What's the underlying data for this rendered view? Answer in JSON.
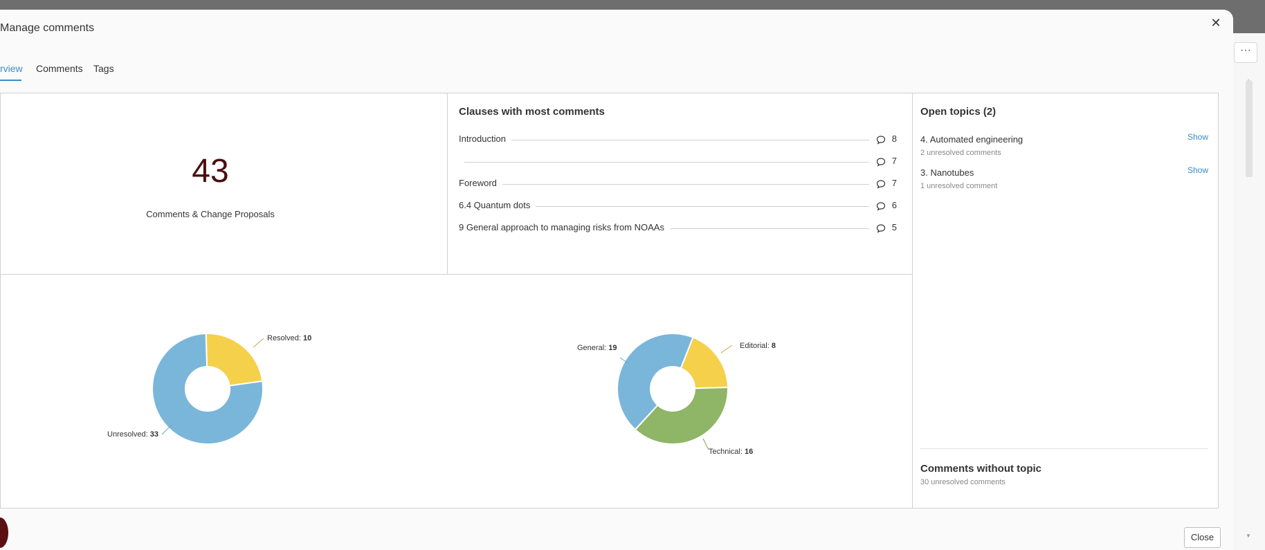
{
  "modal": {
    "title": "Manage comments",
    "close_icon": "close-icon",
    "close_button": "Close"
  },
  "tabs": [
    {
      "label": "rview",
      "active": true
    },
    {
      "label": "Comments",
      "active": false
    },
    {
      "label": "Tags",
      "active": false
    }
  ],
  "summary": {
    "total": "43",
    "label": "Comments & Change Proposals"
  },
  "clauses": {
    "title": "Clauses with most comments",
    "items": [
      {
        "name": "Introduction",
        "count": "8"
      },
      {
        "name": "",
        "count": "7"
      },
      {
        "name": "Foreword",
        "count": "7"
      },
      {
        "name": "6.4 Quantum dots",
        "count": "6"
      },
      {
        "name": "9 General approach to managing risks from NOAAs",
        "count": "5"
      }
    ]
  },
  "topics": {
    "title": "Open topics (2)",
    "items": [
      {
        "name": "4. Automated engineering",
        "sub": "2 unresolved comments",
        "action": "Show"
      },
      {
        "name": "3. Nanotubes",
        "sub": "1 unresolved comment",
        "action": "Show"
      }
    ],
    "without_topic_title": "Comments without topic",
    "without_topic_sub": "30 unresolved comments"
  },
  "chart_data": [
    {
      "type": "pie",
      "categories": [
        "Resolved",
        "Unresolved"
      ],
      "values": [
        10,
        33
      ],
      "colors": [
        "#f5d04a",
        "#7ab6d9"
      ],
      "labels": [
        {
          "name": "Resolved",
          "value": "10"
        },
        {
          "name": "Unresolved",
          "value": "33"
        }
      ]
    },
    {
      "type": "pie",
      "categories": [
        "Editorial",
        "Technical",
        "General"
      ],
      "values": [
        8,
        16,
        19
      ],
      "colors": [
        "#f5d04a",
        "#8fb566",
        "#7ab6d9"
      ],
      "labels": [
        {
          "name": "Editorial",
          "value": "8"
        },
        {
          "name": "Technical",
          "value": "16"
        },
        {
          "name": "General",
          "value": "19"
        }
      ]
    }
  ],
  "background": {
    "more_label": "···"
  }
}
